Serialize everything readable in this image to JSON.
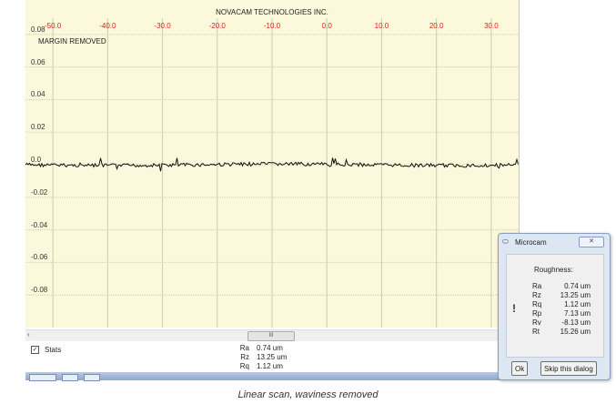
{
  "app": {
    "company": "NOVACAM TECHNOLOGIES INC.",
    "margin_label": "MARGIN REMOVED"
  },
  "chart_data": {
    "type": "line",
    "xlim": [
      -55,
      35
    ],
    "ylim": [
      -0.1,
      0.09
    ],
    "x_ticks": [
      "-50.0",
      "-40.0",
      "-30.0",
      "-20.0",
      "-10.0",
      "0.0",
      "10.0",
      "20.0",
      "30.0"
    ],
    "y_ticks": [
      "0.08",
      "0.06",
      "0.04",
      "0.02",
      "0.0",
      "-0.02",
      "-0.04",
      "-0.06",
      "-0.08"
    ],
    "series": [
      {
        "values_note_free": true,
        "color": "#111111"
      }
    ],
    "profile_baseline": 0.0,
    "grid": true,
    "colors": {
      "background": "#fbf8dc",
      "grid": "#cfcbb0",
      "xtick": "#e0201a"
    }
  },
  "scroll": {
    "arrow": "‹",
    "thumb": "III"
  },
  "stats": {
    "checkbox_label": "Stats",
    "checked": true,
    "rows": [
      {
        "key": "Ra",
        "value": "0.74 um"
      },
      {
        "key": "Rz",
        "value": "13.25 um"
      },
      {
        "key": "Rq",
        "value": "1.12 um"
      }
    ]
  },
  "dialog": {
    "title": "Microcam",
    "heading": "Roughness:",
    "rows": [
      {
        "key": "Ra",
        "value": "0.74 um"
      },
      {
        "key": "Rz",
        "value": "13.25 um"
      },
      {
        "key": "Rq",
        "value": "1.12 um"
      },
      {
        "key": "Rp",
        "value": "7.13 um"
      },
      {
        "key": "Rv",
        "value": "-8.13 um"
      },
      {
        "key": "Rt",
        "value": "15.26 um"
      }
    ],
    "ok_label": "Ok",
    "skip_label": "Skip this dialog"
  },
  "caption": "Linear scan, waviness removed"
}
